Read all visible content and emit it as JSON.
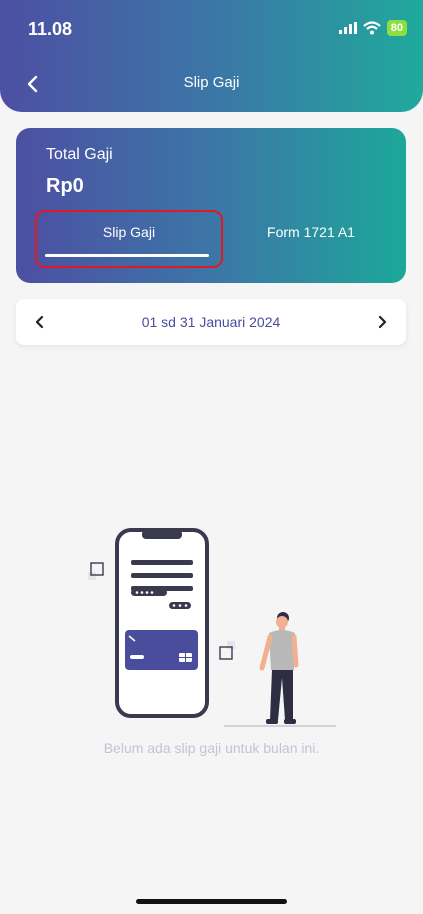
{
  "status_bar": {
    "time": "11.08",
    "battery": "80"
  },
  "header": {
    "title": "Slip Gaji"
  },
  "summary": {
    "label": "Total Gaji",
    "amount": "Rp0",
    "tabs": [
      {
        "label": "Slip Gaji",
        "active": true
      },
      {
        "label": "Form 1721 A1",
        "active": false
      }
    ]
  },
  "period": {
    "label": "01 sd 31 Januari 2024"
  },
  "empty_state": {
    "message": "Belum ada slip gaji untuk bulan ini."
  },
  "colors": {
    "gradient_start": "#4d4fa3",
    "gradient_end": "#1faa9c",
    "accent": "#4a4c9c",
    "highlight": "#e01922"
  }
}
